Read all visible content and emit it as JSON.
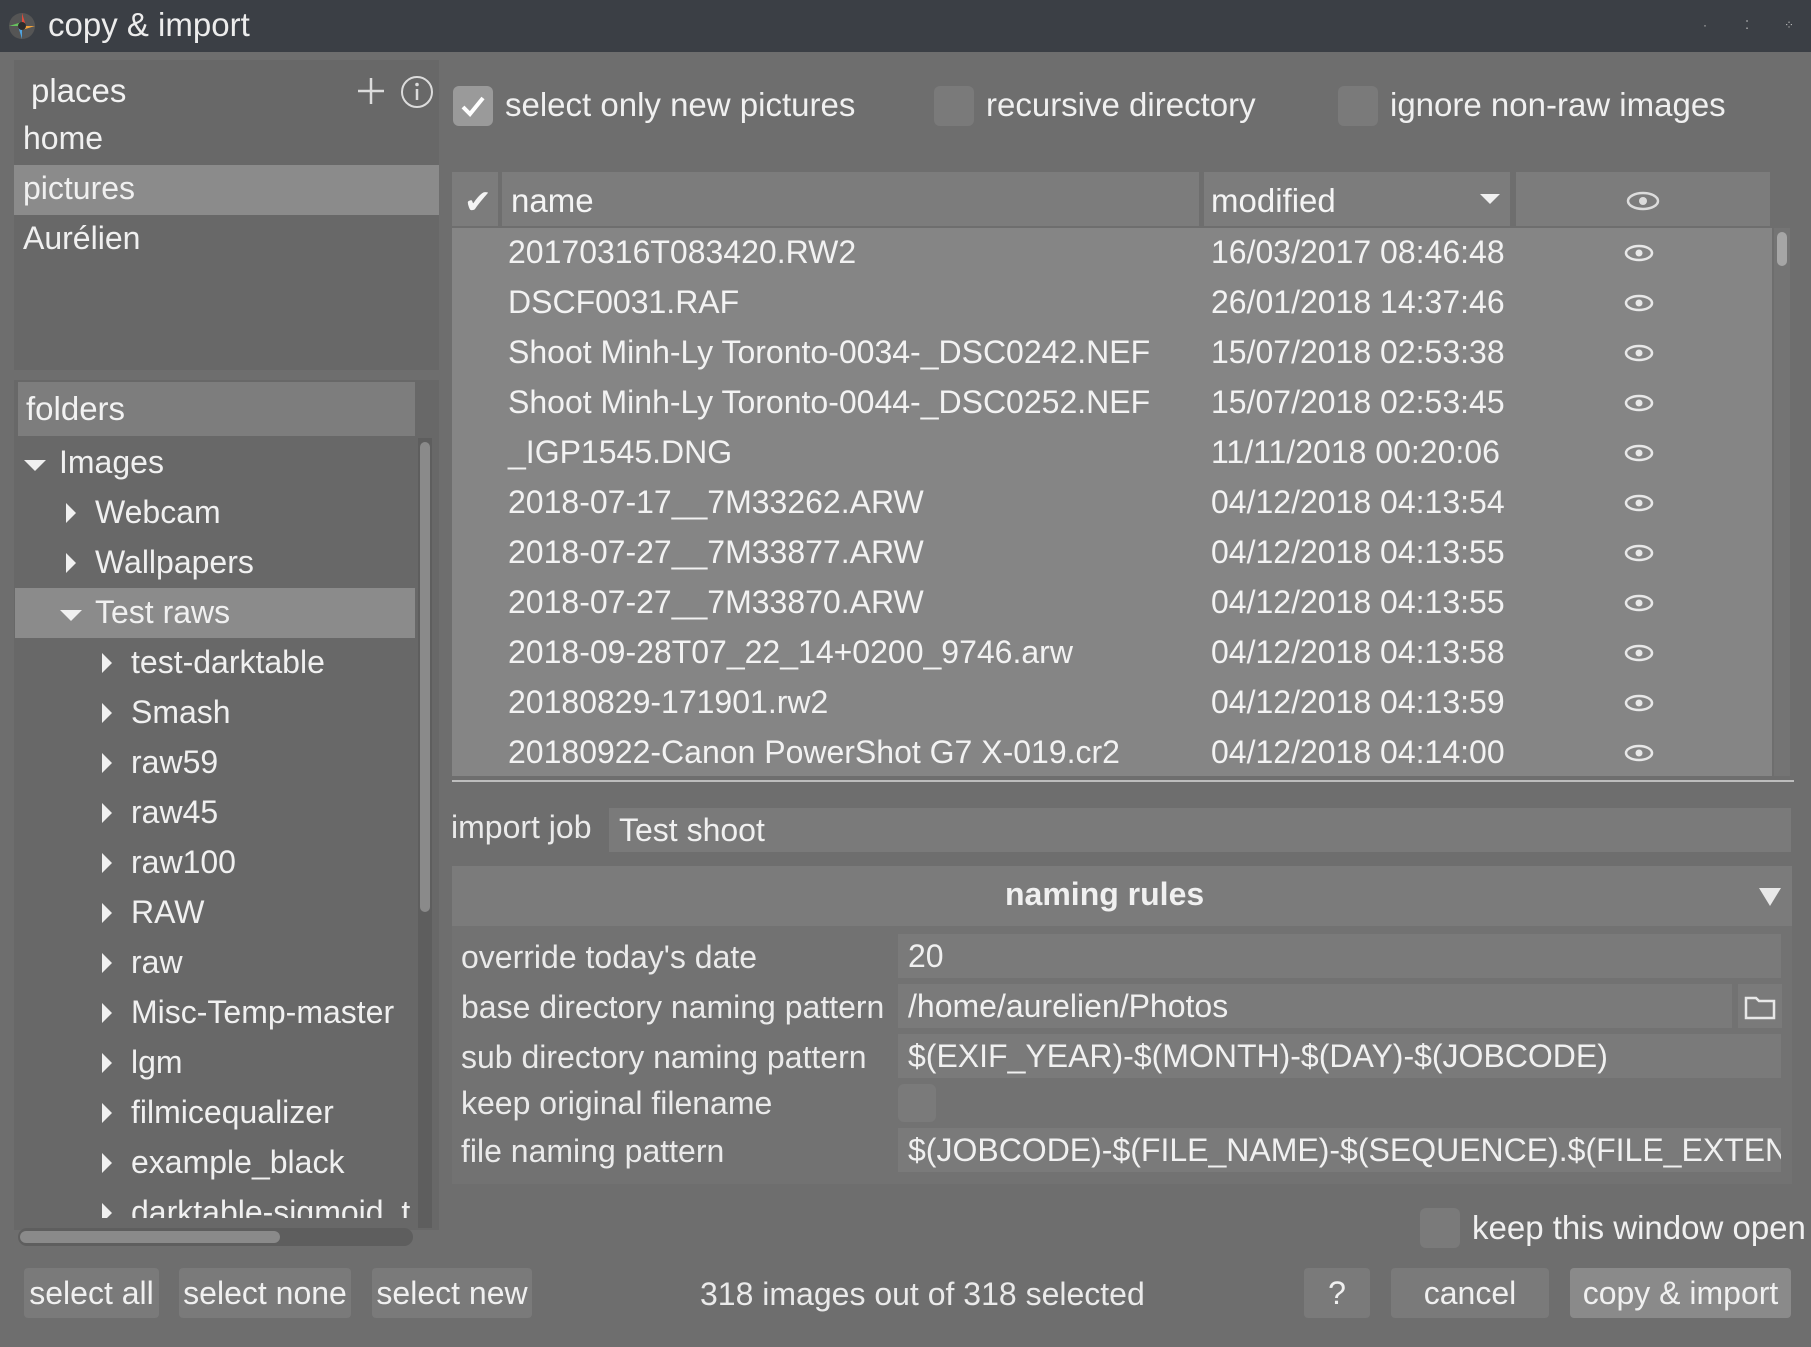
{
  "window": {
    "title": "copy & import",
    "icon": "darktable-logo-icon"
  },
  "places": {
    "header": "places",
    "items": [
      "home",
      "pictures",
      "Aurélien"
    ],
    "selected_index": 1
  },
  "folders": {
    "header": "folders",
    "items": [
      {
        "label": "Images",
        "expanded": true
      },
      {
        "label": "Webcam",
        "expanded": false
      },
      {
        "label": "Wallpapers",
        "expanded": false
      },
      {
        "label": "Test raws",
        "expanded": true
      },
      {
        "label": "test-darktable",
        "expanded": false
      },
      {
        "label": "Smash",
        "expanded": false
      },
      {
        "label": "raw59",
        "expanded": false
      },
      {
        "label": "raw45",
        "expanded": false
      },
      {
        "label": "raw100",
        "expanded": false
      },
      {
        "label": "RAW",
        "expanded": false
      },
      {
        "label": "raw",
        "expanded": false
      },
      {
        "label": "Misc-Temp-master",
        "expanded": false
      },
      {
        "label": "lgm",
        "expanded": false
      },
      {
        "label": "filmicequalizer",
        "expanded": false
      },
      {
        "label": "example_black",
        "expanded": false
      },
      {
        "label": "darktable-sigmoid_t",
        "expanded": false
      }
    ],
    "selected_index": 3
  },
  "options": {
    "select_new": {
      "label": "select only new pictures",
      "checked": true
    },
    "recursive": {
      "label": "recursive directory",
      "checked": false
    },
    "ignore_nonraw": {
      "label": "ignore non-raw images",
      "checked": false
    }
  },
  "file_list": {
    "columns": {
      "check": "✔",
      "name": "name",
      "modified": "modified"
    },
    "rows": [
      {
        "name": "20170316T083420.RW2",
        "modified": "16/03/2017 08:46:48"
      },
      {
        "name": "DSCF0031.RAF",
        "modified": "26/01/2018 14:37:46"
      },
      {
        "name": "Shoot Minh-Ly Toronto-0034-_DSC0242.NEF",
        "modified": "15/07/2018 02:53:38"
      },
      {
        "name": "Shoot Minh-Ly Toronto-0044-_DSC0252.NEF",
        "modified": "15/07/2018 02:53:45"
      },
      {
        "name": "_IGP1545.DNG",
        "modified": "11/11/2018 00:20:06"
      },
      {
        "name": "2018-07-17__7M33262.ARW",
        "modified": "04/12/2018 04:13:54"
      },
      {
        "name": "2018-07-27__7M33877.ARW",
        "modified": "04/12/2018 04:13:55"
      },
      {
        "name": "2018-07-27__7M33870.ARW",
        "modified": "04/12/2018 04:13:55"
      },
      {
        "name": "2018-09-28T07_22_14+0200_9746.arw",
        "modified": "04/12/2018 04:13:58"
      },
      {
        "name": "20180829-171901.rw2",
        "modified": "04/12/2018 04:13:59"
      },
      {
        "name": "20180922-Canon PowerShot G7 X-019.cr2",
        "modified": "04/12/2018 04:14:00"
      }
    ]
  },
  "import_job": {
    "label": "import job",
    "value": "Test shoot"
  },
  "naming_rules": {
    "header": "naming rules",
    "override_date": {
      "label": "override today's date",
      "value": "20"
    },
    "base_dir": {
      "label": "base directory naming pattern",
      "value": "/home/aurelien/Photos"
    },
    "sub_dir": {
      "label": "sub directory naming pattern",
      "value": "$(EXIF_YEAR)-$(MONTH)-$(DAY)-$(JOBCODE)"
    },
    "keep_original": {
      "label": "keep original filename",
      "checked": false
    },
    "file_naming": {
      "label": "file naming pattern",
      "value": "$(JOBCODE)-$(FILE_NAME)-$(SEQUENCE).$(FILE_EXTENSION)"
    }
  },
  "keep_open": {
    "label": "keep this window open",
    "checked": false
  },
  "footer": {
    "select_all": "select all",
    "select_none": "select none",
    "select_new": "select new",
    "status": "318 images out of 318 selected",
    "help": "?",
    "cancel": "cancel",
    "copy_import": "copy & import"
  }
}
